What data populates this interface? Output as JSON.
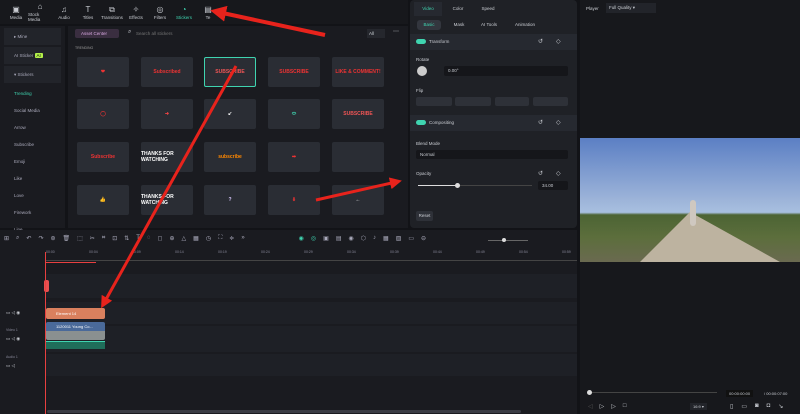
{
  "topbar": {
    "tabs": [
      {
        "label": "Media",
        "icon": "media-icon"
      },
      {
        "label": "Stock Media",
        "icon": "stock-icon"
      },
      {
        "label": "Audio",
        "icon": "music-icon"
      },
      {
        "label": "Titles",
        "icon": "text-icon"
      },
      {
        "label": "Transitions",
        "icon": "transition-icon"
      },
      {
        "label": "Effects",
        "icon": "effects-icon"
      },
      {
        "label": "Filters",
        "icon": "filter-icon"
      },
      {
        "label": "Stickers",
        "icon": "sticker-icon",
        "active": true
      },
      {
        "label": "Te",
        "icon": "template-icon"
      }
    ]
  },
  "sidebar": {
    "mine": "Mine",
    "ai_sticker": "AI Sticker",
    "ai_badge": "AI",
    "stickers": "Stickers",
    "items": [
      "Trending",
      "Social Media",
      "Arrow",
      "Subscribe",
      "Emoji",
      "Like",
      "Love",
      "Firework",
      "Line"
    ]
  },
  "content": {
    "asset_center": "Asset Center",
    "search_placeholder": "Search all stickers",
    "filter": "All",
    "section": "TRENDING",
    "stickers": [
      "❤",
      "Subscribed",
      "SUBSCRIBE",
      "SUBSCRIBE",
      "LIKE & COMMENT!",
      "◯",
      "➜",
      "↙",
      "⬭",
      "SUBSCRIBE",
      "Subscribe",
      "THANKS FOR WATCHING",
      "subscribe",
      "➡",
      "",
      "👍",
      "THANKS FOR WATCHING",
      "?",
      "⬇",
      "←"
    ]
  },
  "panel": {
    "tabs": [
      "Video",
      "Color",
      "Speed"
    ],
    "subtabs": [
      "Basic",
      "Mask",
      "AI Tools",
      "Animation"
    ],
    "transform": "Transform",
    "rotate": "Rotate",
    "rotate_value": "0.00°",
    "flip": "Flip",
    "compositing": "Compositing",
    "blend_mode": "Blend Mode",
    "blend_value": "Normal",
    "opacity": "Opacity",
    "opacity_value": "34.00",
    "reset": "Reset"
  },
  "player": {
    "label": "Player",
    "quality": "Full Quality",
    "current_time": "00:00:00:00",
    "total_time": "/ 00:00:07:00",
    "ratio": "16:9",
    "progress": 0
  },
  "timeline": {
    "ticks": [
      "00:00",
      "00:04",
      "00:09",
      "00:14",
      "00:19",
      "00:24",
      "00:29",
      "00:34",
      "00:39",
      "00:44",
      "00:49",
      "00:54",
      "00:59"
    ],
    "video_track": "Video 1",
    "audio_track": "Audio 1",
    "sticker_clip": "Element 14",
    "video_clip": "1120011 Young Co..."
  },
  "colors": {
    "accent": "#3fd4b0",
    "arrow": "#e8231c",
    "sticker_clip": "#d9805e",
    "video_clip": "#4a6a9a"
  }
}
